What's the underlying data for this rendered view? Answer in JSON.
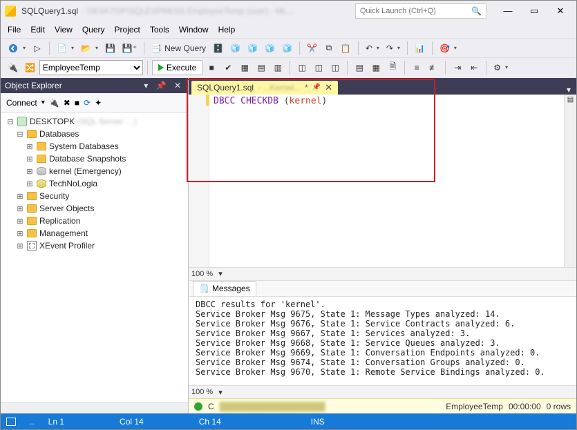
{
  "title": {
    "filename": "SQLQuery1.sql",
    "suffix_blurred": "- DESKTOP\\SQLEXPRESS.EmployeeTemp (user) - ML..."
  },
  "quick_launch_placeholder": "Quick Launch (Ctrl+Q)",
  "menu": [
    "File",
    "Edit",
    "View",
    "Query",
    "Project",
    "Tools",
    "Window",
    "Help"
  ],
  "toolbar1": {
    "new_query_label": "New Query"
  },
  "toolbar2": {
    "db_selected": "EmployeeTemp",
    "execute_label": "Execute"
  },
  "object_explorer": {
    "title": "Object Explorer",
    "connect_label": "Connect",
    "server_label": "DESKTOPK",
    "server_label_blur": " (SQL Server …)",
    "databases_label": "Databases",
    "sys_db_label": "System Databases",
    "db_snap_label": "Database Snapshots",
    "db_kernel_label": "kernel (Emergency)",
    "db_tech_label": "TechNoLogia",
    "security_label": "Security",
    "server_objects_label": "Server Objects",
    "replication_label": "Replication",
    "management_label": "Management",
    "xe_label": "XEvent Profiler"
  },
  "editor": {
    "tab_label": "SQLQuery1.sql",
    "tab_blur": "- ...Kernel...",
    "tab_modified": "*",
    "code_cmd": "DBCC CHECKDB ",
    "code_arg": "kernel",
    "zoom": "100 %"
  },
  "messages": {
    "tab_label": "Messages",
    "zoom": "100 %",
    "lines": [
      "DBCC results for 'kernel'.",
      "Service Broker Msg 9675, State 1: Message Types analyzed: 14.",
      "Service Broker Msg 9676, State 1: Service Contracts analyzed: 6.",
      "Service Broker Msg 9667, State 1: Services analyzed: 3.",
      "Service Broker Msg 9668, State 1: Service Queues analyzed: 3.",
      "Service Broker Msg 9669, State 1: Conversation Endpoints analyzed: 0.",
      "Service Broker Msg 9674, State 1: Conversation Groups analyzed: 0.",
      "Service Broker Msg 9670, State 1: Remote Service Bindings analyzed: 0."
    ]
  },
  "status": {
    "label_c": "C",
    "db": "EmployeeTemp",
    "elapsed": "00:00:00",
    "rows": "0 rows"
  },
  "bottom": {
    "ready": "..",
    "ln": "Ln 1",
    "col": "Col 14",
    "ch": "Ch 14",
    "ins": "INS"
  }
}
